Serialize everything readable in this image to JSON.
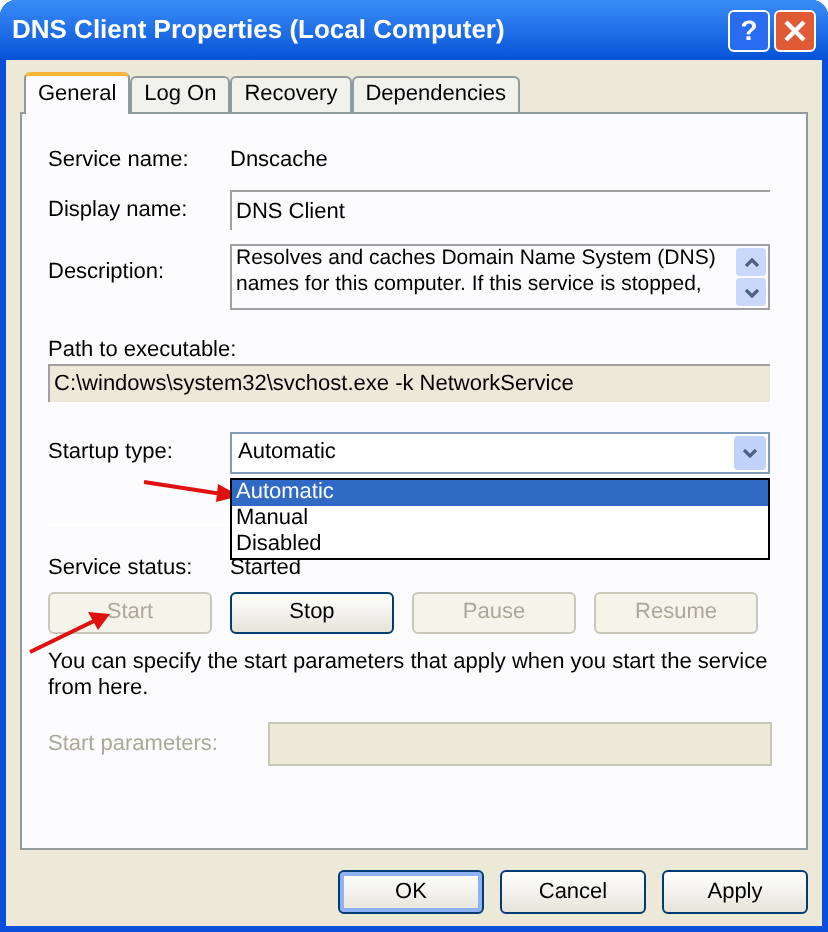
{
  "window": {
    "title": "DNS Client Properties (Local Computer)",
    "help": "?"
  },
  "tabs": [
    {
      "label": "General",
      "selected": true
    },
    {
      "label": "Log On",
      "selected": false
    },
    {
      "label": "Recovery",
      "selected": false
    },
    {
      "label": "Dependencies",
      "selected": false
    }
  ],
  "service_name": {
    "label": "Service name:",
    "value": "Dnscache"
  },
  "display_name": {
    "label": "Display name:",
    "value": "DNS Client"
  },
  "description": {
    "label": "Description:",
    "value": "Resolves and caches Domain Name System (DNS) names for this computer. If this service is stopped,"
  },
  "path": {
    "label": "Path to executable:",
    "value": "C:\\windows\\system32\\svchost.exe -k NetworkService"
  },
  "startup_type": {
    "label": "Startup type:",
    "value": "Automatic",
    "expanded": true,
    "options": [
      {
        "label": "Automatic",
        "selected": true
      },
      {
        "label": "Manual",
        "selected": false
      },
      {
        "label": "Disabled",
        "selected": false
      }
    ]
  },
  "service_status": {
    "label": "Service status:",
    "value": "Started"
  },
  "service_buttons": [
    {
      "label": "Start",
      "disabled": true
    },
    {
      "label": "Stop",
      "disabled": false
    },
    {
      "label": "Pause",
      "disabled": true
    },
    {
      "label": "Resume",
      "disabled": true
    }
  ],
  "note": "You can specify the start parameters that apply when you start the service from here.",
  "start_parameters": {
    "label": "Start parameters:",
    "disabled": true
  },
  "dialog_buttons": [
    {
      "label": "OK",
      "default": true
    },
    {
      "label": "Cancel",
      "default": false
    },
    {
      "label": "Apply",
      "default": false
    }
  ]
}
